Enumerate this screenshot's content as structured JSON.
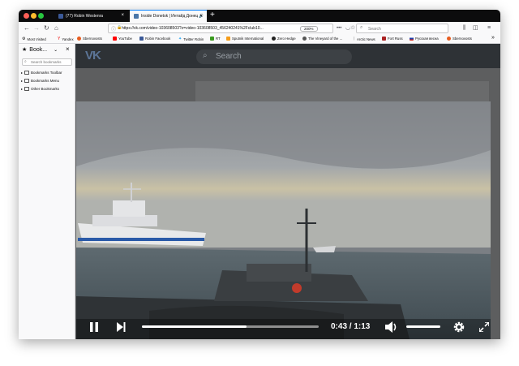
{
  "tabs": [
    {
      "title": "(77) Robin Westenra",
      "close": "×"
    },
    {
      "title": "Inside Donetsk | Интайд Донецк",
      "close": "×"
    }
  ],
  "newtab_label": "+",
  "nav": {
    "url": "https://vk.com/video-103608503?z=video-103608503_456240241%2Fclub10...",
    "zoom": "200%",
    "search_placeholder": "Search",
    "more": "•••"
  },
  "bookmarks": [
    "Most Visited",
    "Yandex",
    "Sbernovosts",
    "YouTube",
    "Robin Facebook",
    "Twitter Robin",
    "RT",
    "Sputnik International",
    "Zero Hedge",
    "The Vineyard of the ...",
    "Arctic News",
    "Fort Russ",
    "Русская весна",
    "Sbernovosts"
  ],
  "bookmarks_overflow": "»",
  "sidebar": {
    "title": "Book...",
    "search_placeholder": "Search bookmarks",
    "items": [
      "Bookmarks Toolbar",
      "Bookmarks Menu",
      "Other Bookmarks"
    ]
  },
  "vk": {
    "logo": "VK",
    "search_placeholder": "Search"
  },
  "video": {
    "time": "0:43 / 1:13",
    "progress": 0.59
  },
  "colors": {
    "tab_bg": "#0c0c0d",
    "vk_header": "#2e3236",
    "accent": "#0a84ff"
  }
}
